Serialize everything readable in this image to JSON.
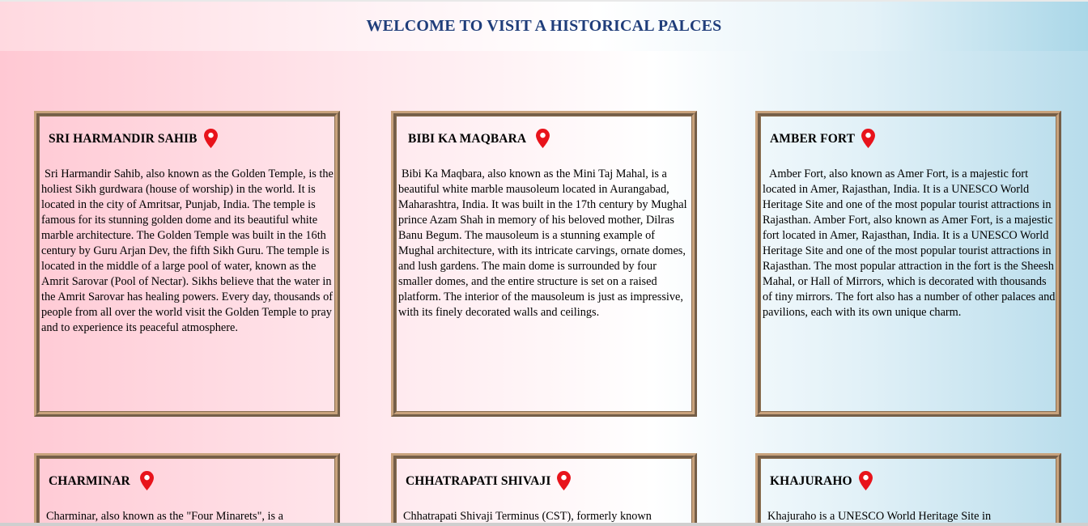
{
  "page": {
    "title": "WELCOME TO VISIT A HISTORICAL PALCES"
  },
  "icons": {
    "location": "map-pin-icon",
    "pin_color": "#e8131b"
  },
  "colors": {
    "title": "#1f3d7a",
    "card_border": "#c8a27c"
  },
  "cards": [
    {
      "title": "SRI HARMANDIR SAHIB",
      "text": "Sri Harmandir Sahib, also known as the Golden Temple, is the holiest Sikh gurdwara (house of worship) in the world. It is located in the city of Amritsar, Punjab, India. The temple is famous for its stunning golden dome and its beautiful white marble architecture. The Golden Temple was built in the 16th century by Guru Arjan Dev, the fifth Sikh Guru. The temple is located in the middle of a large pool of water, known as the Amrit Sarovar (Pool of Nectar). Sikhs believe that the water in the Amrit Sarovar has healing powers. Every day, thousands of people from all over the world visit the Golden Temple to pray and to experience its peaceful atmosphere."
    },
    {
      "title": "BIBI KA MAQBARA",
      "text": "Bibi Ka Maqbara, also known as the Mini Taj Mahal, is a beautiful white marble mausoleum located in Aurangabad, Maharashtra, India. It was built in the 17th century by Mughal prince Azam Shah in memory of his beloved mother, Dilras Banu Begum. The mausoleum is a stunning example of Mughal architecture, with its intricate carvings, ornate domes, and lush gardens. The main dome is surrounded by four smaller domes, and the entire structure is set on a raised platform. The interior of the mausoleum is just as impressive, with its finely decorated walls and ceilings."
    },
    {
      "title": "AMBER FORT",
      "text": "Amber Fort, also known as Amer Fort, is a majestic fort located in Amer, Rajasthan, India. It is a UNESCO World Heritage Site and one of the most popular tourist attractions in Rajasthan. Amber Fort, also known as Amer Fort, is a majestic fort located in Amer, Rajasthan, India. It is a UNESCO World Heritage Site and one of the most popular tourist attractions in Rajasthan. The most popular attraction in the fort is the Sheesh Mahal, or Hall of Mirrors, which is decorated with thousands of tiny mirrors. The fort also has a number of other palaces and pavilions, each with its own unique charm."
    },
    {
      "title": "CHARMINAR",
      "text": "Charminar, also known as the \"Four Minarets\", is a"
    },
    {
      "title": "CHHATRAPATI SHIVAJI",
      "text": "Chhatrapati Shivaji Terminus (CST), formerly known"
    },
    {
      "title": "KHAJURAHO",
      "text": "Khajuraho is a UNESCO World Heritage Site in"
    }
  ]
}
